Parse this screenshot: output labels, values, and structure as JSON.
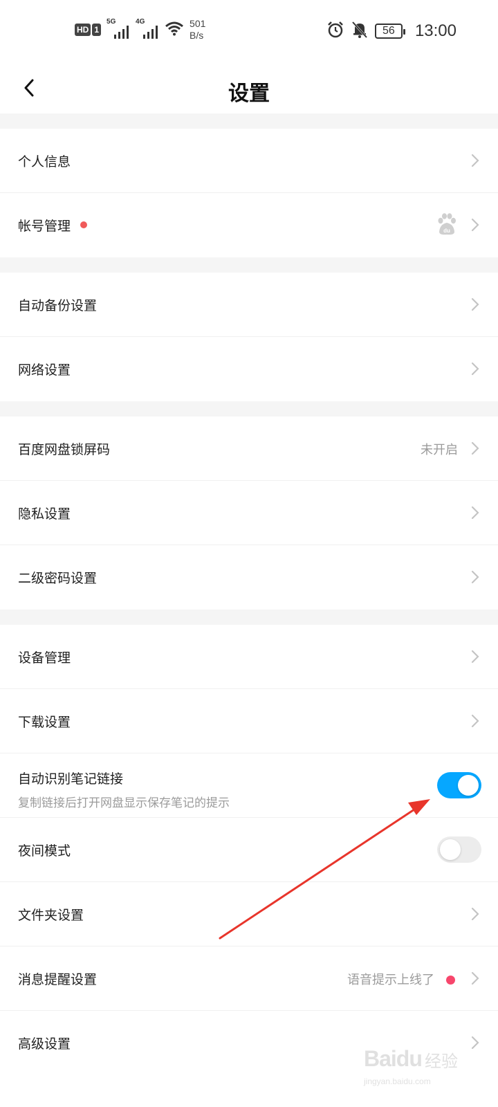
{
  "status_bar": {
    "hd_label": "HD",
    "sim_number": "1",
    "sig1_label": "5G",
    "sig2_label": "4G",
    "net_speed_value": "501",
    "net_speed_unit": "B/s",
    "battery": "56",
    "time": "13:00"
  },
  "header": {
    "title": "设置"
  },
  "rows": {
    "personal_info": {
      "label": "个人信息"
    },
    "account": {
      "label": "帐号管理"
    },
    "auto_backup": {
      "label": "自动备份设置"
    },
    "network": {
      "label": "网络设置"
    },
    "lock_code": {
      "label": "百度网盘锁屏码",
      "value": "未开启"
    },
    "privacy": {
      "label": "隐私设置"
    },
    "second_password": {
      "label": "二级密码设置"
    },
    "device": {
      "label": "设备管理"
    },
    "download": {
      "label": "下载设置"
    },
    "note_link": {
      "label": "自动识别笔记链接",
      "subtitle": "复制链接后打开网盘显示保存笔记的提示",
      "enabled": true
    },
    "night_mode": {
      "label": "夜间模式",
      "enabled": false
    },
    "folder": {
      "label": "文件夹设置"
    },
    "message": {
      "label": "消息提醒设置",
      "value": "语音提示上线了"
    },
    "advanced": {
      "label": "高级设置"
    }
  },
  "colors": {
    "toggle_on": "#06a7ff",
    "toggle_off": "#ececec",
    "red_dot": "#f05a5a",
    "annotation_arrow": "#e8352b"
  },
  "watermark": {
    "logo": "Baidu",
    "brand": "经验",
    "url": "jingyan.baidu.com"
  }
}
